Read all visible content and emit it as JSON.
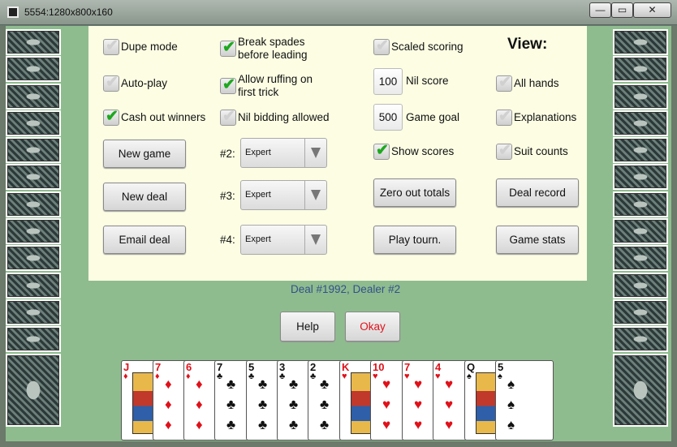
{
  "window": {
    "title": "5554:1280x800x160",
    "min": "—",
    "max": "▭",
    "close": "✕"
  },
  "options": {
    "dupe_mode": "Dupe mode",
    "auto_play": "Auto-play",
    "cash_out": "Cash out winners",
    "break_spades_1": "Break spades",
    "break_spades_2": "before leading",
    "allow_ruffing_1": "Allow ruffing on",
    "allow_ruffing_2": "first trick",
    "nil_bidding": "Nil bidding allowed",
    "scaled_scoring": "Scaled scoring",
    "show_scores": "Show scores"
  },
  "nil_score": {
    "value": "100",
    "label": "Nil score"
  },
  "game_goal": {
    "value": "500",
    "label": "Game goal"
  },
  "view": {
    "title": "View:",
    "all_hands": "All hands",
    "explanations": "Explanations",
    "suit_counts": "Suit counts"
  },
  "buttons": {
    "new_game": "New game",
    "new_deal": "New deal",
    "email_deal": "Email deal",
    "zero_out": "Zero out totals",
    "play_tourn": "Play tourn.",
    "deal_record": "Deal record",
    "game_stats": "Game stats",
    "help": "Help",
    "okay": "Okay"
  },
  "players": [
    {
      "label": "#2:",
      "level": "Expert"
    },
    {
      "label": "#3:",
      "level": "Expert"
    },
    {
      "label": "#4:",
      "level": "Expert"
    }
  ],
  "deal_info": "Deal #1992, Dealer #2",
  "hand": [
    {
      "rank": "J",
      "suit": "♦"
    },
    {
      "rank": "7",
      "suit": "♦"
    },
    {
      "rank": "6",
      "suit": "♦"
    },
    {
      "rank": "7",
      "suit": "♣"
    },
    {
      "rank": "5",
      "suit": "♣"
    },
    {
      "rank": "3",
      "suit": "♣"
    },
    {
      "rank": "2",
      "suit": "♣"
    },
    {
      "rank": "K",
      "suit": "♥"
    },
    {
      "rank": "10",
      "suit": "♥"
    },
    {
      "rank": "7",
      "suit": "♥"
    },
    {
      "rank": "4",
      "suit": "♥"
    },
    {
      "rank": "Q",
      "suit": "♠"
    },
    {
      "rank": "5",
      "suit": "♠"
    }
  ],
  "colors": {
    "table": "#8fbc8f",
    "panel": "#fcfde3",
    "okay_text": "#e0111a",
    "deal_info": "#34508a"
  }
}
